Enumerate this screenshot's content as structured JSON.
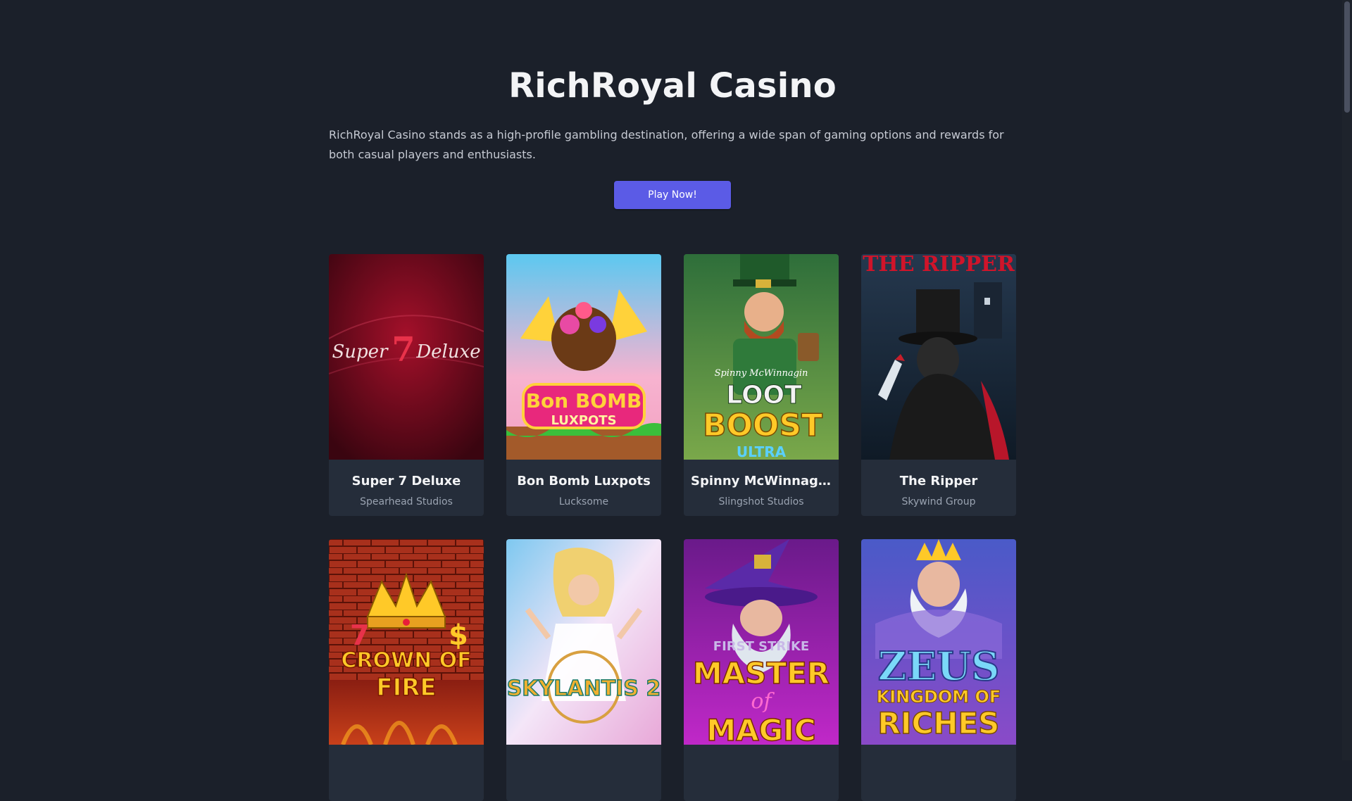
{
  "title": "RichRoyal Casino",
  "description": "RichRoyal Casino stands as a high-profile gambling destination, offering a wide span of gaming options and rewards for both casual players and enthusiasts.",
  "cta_label": "Play Now!",
  "colors": {
    "background": "#1b202a",
    "card": "#252d3a",
    "accent": "#5b5be6"
  },
  "games": [
    {
      "name": "Super 7 Deluxe",
      "provider": "Spearhead Studios",
      "art_text": [
        "Super",
        "7",
        "Deluxe"
      ],
      "icon": "super-7-deluxe-art"
    },
    {
      "name": "Bon Bomb Luxpots",
      "provider": "Lucksome",
      "art_text": [
        "Bon BOMB",
        "LUXPOTS"
      ],
      "icon": "bon-bomb-luxpots-art"
    },
    {
      "name": "Spinny McWinnagin...",
      "provider": "Slingshot Studios",
      "art_text": [
        "Spinny McWinnagin",
        "LOOT",
        "BOOST",
        "ULTRA"
      ],
      "icon": "loot-boost-art"
    },
    {
      "name": "The Ripper",
      "provider": "Skywind Group",
      "art_text": [
        "THE RIPPER"
      ],
      "icon": "the-ripper-art"
    },
    {
      "name": "",
      "provider": "",
      "art_text": [
        "CROWN OF",
        "FIRE"
      ],
      "icon": "crown-of-fire-art"
    },
    {
      "name": "",
      "provider": "",
      "art_text": [
        "SKYLANTIS 2"
      ],
      "icon": "skylantis-2-art"
    },
    {
      "name": "",
      "provider": "",
      "art_text": [
        "FIRST STRIKE",
        "MASTER",
        "of",
        "MAGIC"
      ],
      "icon": "master-of-magic-art"
    },
    {
      "name": "",
      "provider": "",
      "art_text": [
        "ZEUS",
        "KINGDOM OF",
        "RICHES"
      ],
      "icon": "zeus-kingdom-of-riches-art"
    }
  ]
}
